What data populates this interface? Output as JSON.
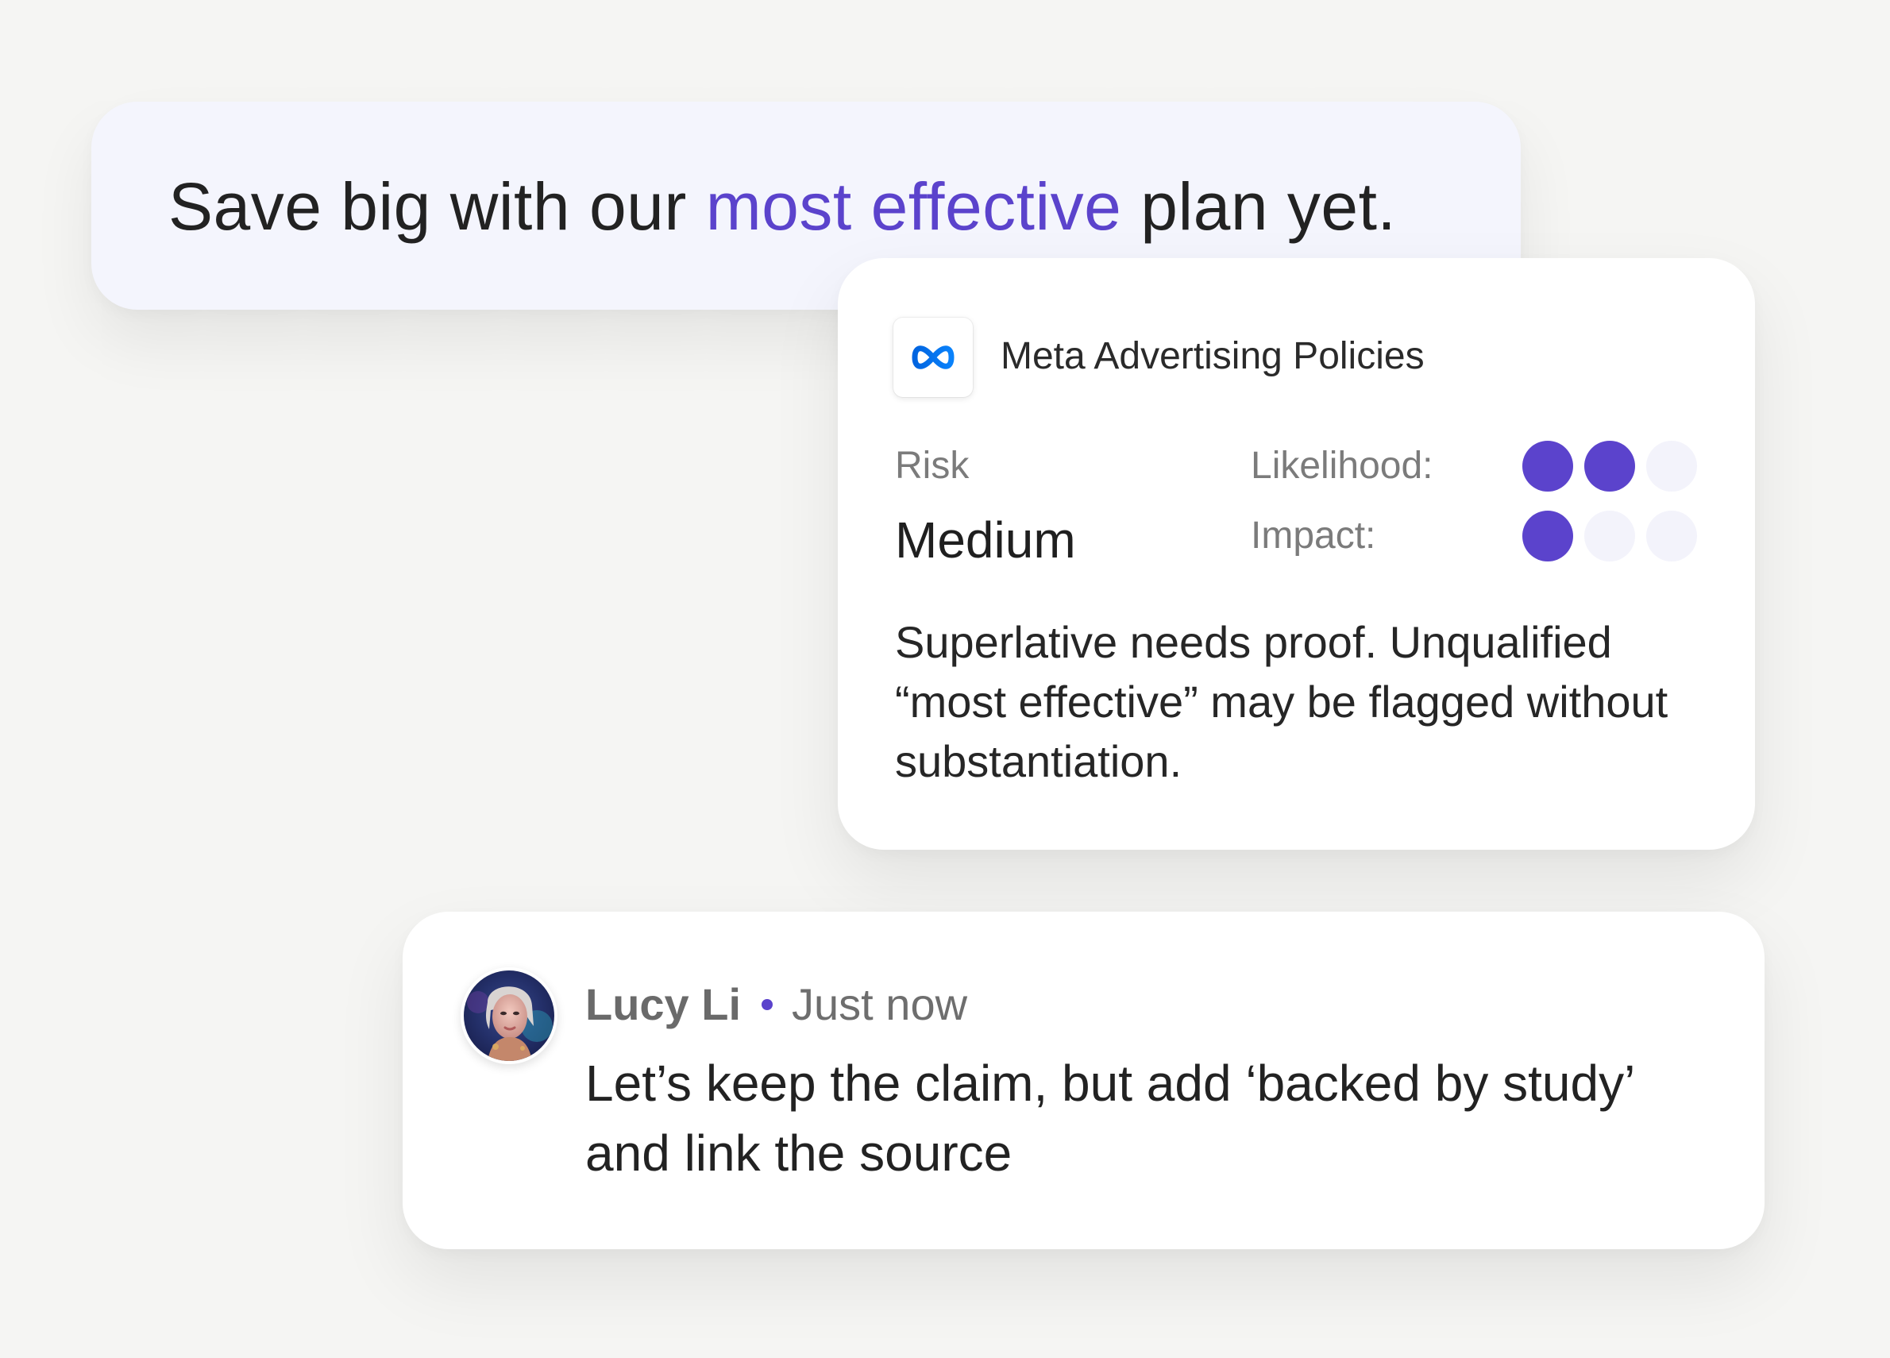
{
  "banner": {
    "text_before": "Save big with our ",
    "highlight": "most effective",
    "text_after": " plan yet."
  },
  "policy_card": {
    "logo_icon": "meta-logo-icon",
    "title": "Meta Advertising Policies",
    "risk_label": "Risk",
    "risk_value": "Medium",
    "likelihood_label": "Likelihood:",
    "likelihood_level": 2,
    "impact_label": "Impact:",
    "impact_level": 1,
    "max_level": 3,
    "description": "Superlative needs proof. Unqualified “most effective” may be flagged without substantiation."
  },
  "comment": {
    "author": "Lucy Li",
    "time": "Just now",
    "body": "Let’s keep the claim, but add ‘backed by study’ and link the source"
  },
  "colors": {
    "accent": "#5b43cc",
    "dot_off": "#f3f3fb",
    "banner_bg": "#f4f5fd",
    "page_bg": "#f5f5f3",
    "meta_blue": "#0a7cff"
  }
}
